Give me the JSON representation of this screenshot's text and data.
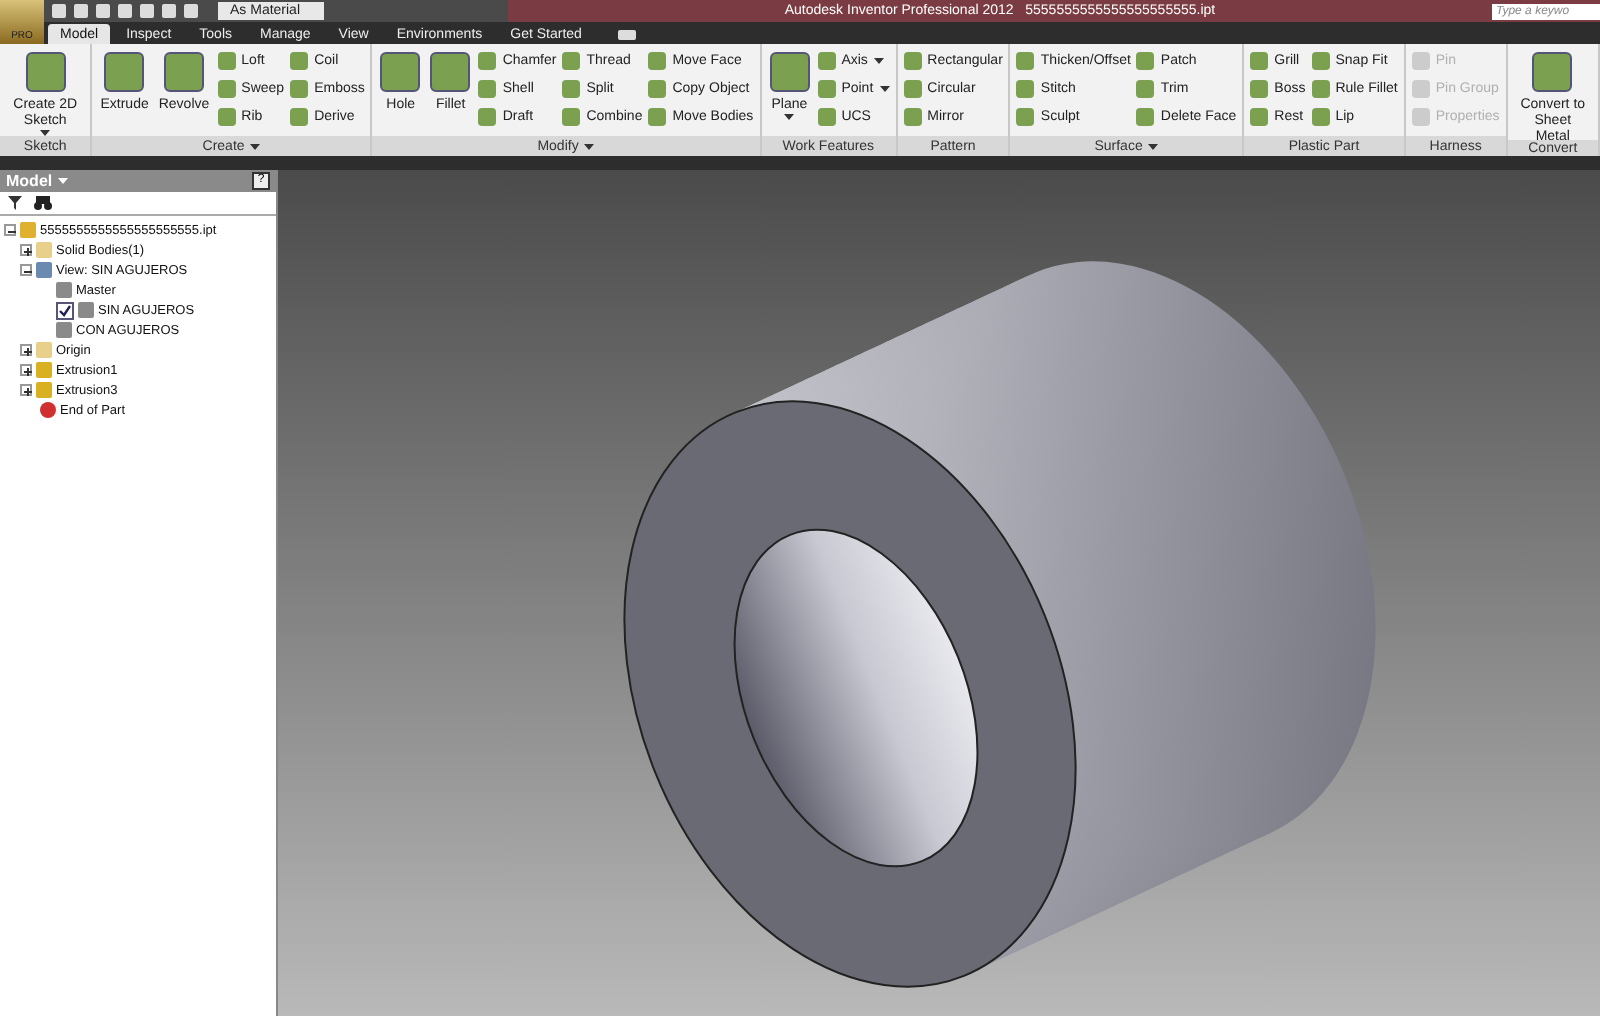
{
  "app_button": {
    "label": "PRO"
  },
  "quick_access": {
    "material": "As Material"
  },
  "window": {
    "title": "Autodesk Inventor Professional 2012",
    "file": "5555555555555555555555.ipt"
  },
  "search": {
    "placeholder": "Type a keywo"
  },
  "tabs": [
    {
      "label": "Model",
      "selected": true
    },
    {
      "label": "Inspect",
      "selected": false
    },
    {
      "label": "Tools",
      "selected": false
    },
    {
      "label": "Manage",
      "selected": false
    },
    {
      "label": "View",
      "selected": false
    },
    {
      "label": "Environments",
      "selected": false
    },
    {
      "label": "Get Started",
      "selected": false
    }
  ],
  "ribbon": [
    {
      "label": "Sketch",
      "menu": false,
      "columns": [
        [
          {
            "kind": "large",
            "label": "Create 2D Sketch",
            "caret": true,
            "disabled": false
          }
        ]
      ]
    },
    {
      "label": "Create",
      "menu": true,
      "columns": [
        [
          {
            "kind": "large",
            "label": "Extrude",
            "caret": false,
            "disabled": false
          }
        ],
        [
          {
            "kind": "large",
            "label": "Revolve",
            "caret": false,
            "disabled": false
          }
        ],
        [
          {
            "kind": "small",
            "label": "Loft",
            "caret": false,
            "disabled": false
          },
          {
            "kind": "small",
            "label": "Sweep",
            "caret": false,
            "disabled": false
          },
          {
            "kind": "small",
            "label": "Rib",
            "caret": false,
            "disabled": false
          }
        ],
        [
          {
            "kind": "small",
            "label": "Coil",
            "caret": false,
            "disabled": false
          },
          {
            "kind": "small",
            "label": "Emboss",
            "caret": false,
            "disabled": false
          },
          {
            "kind": "small",
            "label": "Derive",
            "caret": false,
            "disabled": false
          }
        ]
      ]
    },
    {
      "label": "Modify",
      "menu": true,
      "columns": [
        [
          {
            "kind": "large",
            "label": "Hole",
            "caret": false,
            "disabled": false
          }
        ],
        [
          {
            "kind": "large",
            "label": "Fillet",
            "caret": false,
            "disabled": false
          }
        ],
        [
          {
            "kind": "small",
            "label": "Chamfer",
            "caret": false,
            "disabled": false
          },
          {
            "kind": "small",
            "label": "Shell",
            "caret": false,
            "disabled": false
          },
          {
            "kind": "small",
            "label": "Draft",
            "caret": false,
            "disabled": false
          }
        ],
        [
          {
            "kind": "small",
            "label": "Thread",
            "caret": false,
            "disabled": false
          },
          {
            "kind": "small",
            "label": "Split",
            "caret": false,
            "disabled": false
          },
          {
            "kind": "small",
            "label": "Combine",
            "caret": false,
            "disabled": false
          }
        ],
        [
          {
            "kind": "small",
            "label": "Move Face",
            "caret": false,
            "disabled": false
          },
          {
            "kind": "small",
            "label": "Copy Object",
            "caret": false,
            "disabled": false
          },
          {
            "kind": "small",
            "label": "Move Bodies",
            "caret": false,
            "disabled": false
          }
        ]
      ]
    },
    {
      "label": "Work Features",
      "menu": false,
      "columns": [
        [
          {
            "kind": "large",
            "label": "Plane",
            "caret": true,
            "disabled": false
          }
        ],
        [
          {
            "kind": "small",
            "label": "Axis",
            "caret": true,
            "disabled": false
          },
          {
            "kind": "small",
            "label": "Point",
            "caret": true,
            "disabled": false
          },
          {
            "kind": "small",
            "label": "UCS",
            "caret": false,
            "disabled": false
          }
        ]
      ]
    },
    {
      "label": "Pattern",
      "menu": false,
      "columns": [
        [
          {
            "kind": "small",
            "label": "Rectangular",
            "caret": false,
            "disabled": false
          },
          {
            "kind": "small",
            "label": "Circular",
            "caret": false,
            "disabled": false
          },
          {
            "kind": "small",
            "label": "Mirror",
            "caret": false,
            "disabled": false
          }
        ]
      ]
    },
    {
      "label": "Surface",
      "menu": true,
      "columns": [
        [
          {
            "kind": "small",
            "label": "Thicken/Offset",
            "caret": false,
            "disabled": false
          },
          {
            "kind": "small",
            "label": "Stitch",
            "caret": false,
            "disabled": false
          },
          {
            "kind": "small",
            "label": "Sculpt",
            "caret": false,
            "disabled": false
          }
        ],
        [
          {
            "kind": "small",
            "label": "Patch",
            "caret": false,
            "disabled": false
          },
          {
            "kind": "small",
            "label": "Trim",
            "caret": false,
            "disabled": false
          },
          {
            "kind": "small",
            "label": "Delete Face",
            "caret": false,
            "disabled": false
          }
        ]
      ]
    },
    {
      "label": "Plastic Part",
      "menu": false,
      "columns": [
        [
          {
            "kind": "small",
            "label": "Grill",
            "caret": false,
            "disabled": false
          },
          {
            "kind": "small",
            "label": "Boss",
            "caret": false,
            "disabled": false
          },
          {
            "kind": "small",
            "label": "Rest",
            "caret": false,
            "disabled": false
          }
        ],
        [
          {
            "kind": "small",
            "label": "Snap Fit",
            "caret": false,
            "disabled": false
          },
          {
            "kind": "small",
            "label": "Rule Fillet",
            "caret": false,
            "disabled": false
          },
          {
            "kind": "small",
            "label": "Lip",
            "caret": false,
            "disabled": false
          }
        ]
      ]
    },
    {
      "label": "Harness",
      "menu": false,
      "columns": [
        [
          {
            "kind": "small",
            "label": "Pin",
            "caret": false,
            "disabled": true
          },
          {
            "kind": "small",
            "label": "Pin Group",
            "caret": false,
            "disabled": true
          },
          {
            "kind": "small",
            "label": "Properties",
            "caret": false,
            "disabled": true
          }
        ]
      ]
    },
    {
      "label": "Convert",
      "menu": false,
      "columns": [
        [
          {
            "kind": "large",
            "label": "Convert to Sheet Metal",
            "caret": false,
            "disabled": false
          }
        ]
      ]
    }
  ],
  "browser": {
    "title": "Model",
    "help": "?",
    "tree": [
      {
        "kind": "part",
        "label": "5555555555555555555555.ipt",
        "expanded": true,
        "children": [
          {
            "kind": "folder",
            "label": "Solid Bodies(1)",
            "expanded": false
          },
          {
            "kind": "view",
            "label": "View: SIN AGUJEROS",
            "expanded": true,
            "children": [
              {
                "kind": "lock",
                "label": "Master",
                "checked": false
              },
              {
                "kind": "lock",
                "label": "SIN AGUJEROS",
                "checked": true
              },
              {
                "kind": "lock",
                "label": "CON AGUJEROS",
                "checked": false
              }
            ]
          },
          {
            "kind": "folder",
            "label": "Origin",
            "expanded": false
          },
          {
            "kind": "feature",
            "label": "Extrusion1",
            "expanded": false
          },
          {
            "kind": "feature",
            "label": "Extrusion3",
            "expanded": false
          },
          {
            "kind": "end",
            "label": "End of Part"
          }
        ]
      }
    ]
  }
}
